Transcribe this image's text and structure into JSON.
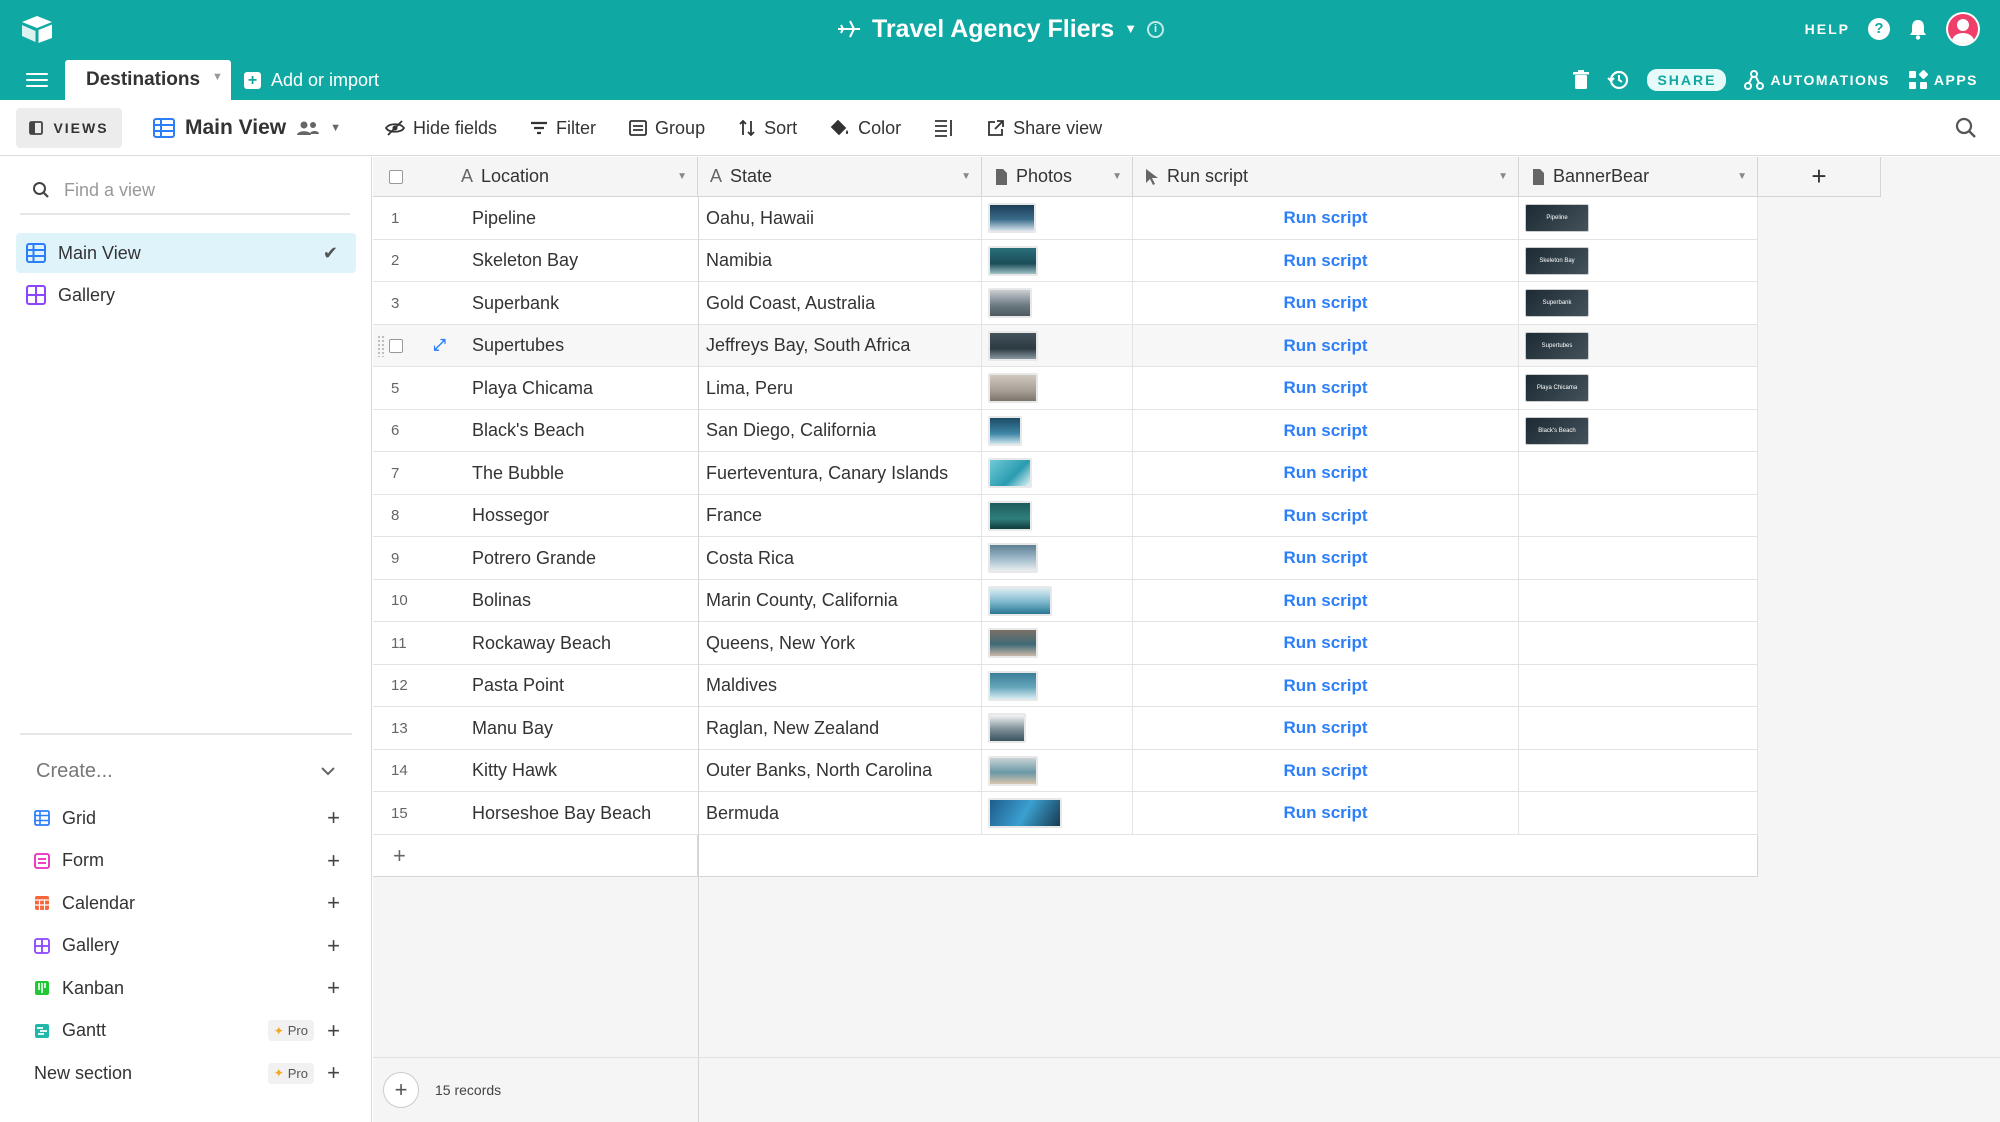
{
  "app": {
    "title": "Travel Agency Fliers",
    "help_label": "HELP",
    "share_label": "SHARE",
    "automations_label": "AUTOMATIONS",
    "apps_label": "APPS",
    "accent_color": "#0fa8a3"
  },
  "tabs": {
    "active_label": "Destinations",
    "add_import_label": "Add or import"
  },
  "toolbar": {
    "views_label": "VIEWS",
    "view_name": "Main View",
    "hide_fields": "Hide fields",
    "filter": "Filter",
    "group": "Group",
    "sort": "Sort",
    "color": "Color",
    "share_view": "Share view"
  },
  "sidebar": {
    "find_placeholder": "Find a view",
    "views": [
      {
        "label": "Main View",
        "icon": "grid-icon",
        "active": true
      },
      {
        "label": "Gallery",
        "icon": "gallery-icon",
        "active": false
      }
    ],
    "create_label": "Create...",
    "create_items": [
      {
        "label": "Grid",
        "icon": "grid-icon",
        "color": "#2d7ff9"
      },
      {
        "label": "Form",
        "icon": "form-icon",
        "color": "#e929ba"
      },
      {
        "label": "Calendar",
        "icon": "calendar-icon",
        "color": "#f7653b"
      },
      {
        "label": "Gallery",
        "icon": "gallery-icon",
        "color": "#8b46ff"
      },
      {
        "label": "Kanban",
        "icon": "kanban-icon",
        "color": "#20c933"
      },
      {
        "label": "Gantt",
        "icon": "gantt-icon",
        "color": "#20b8a8",
        "pro": "Pro"
      },
      {
        "label": "New section",
        "icon": "",
        "pro": "Pro"
      }
    ]
  },
  "table": {
    "columns": [
      "Location",
      "State",
      "Photos",
      "Run script",
      "BannerBear"
    ],
    "button_label": "Run script",
    "rows": [
      {
        "num": "1",
        "location": "Pipeline",
        "state": "Oahu, Hawaii",
        "banner": "Pipeline"
      },
      {
        "num": "2",
        "location": "Skeleton Bay",
        "state": "Namibia",
        "banner": "Skeleton Bay"
      },
      {
        "num": "3",
        "location": "Superbank",
        "state": "Gold Coast, Australia",
        "banner": "Superbank"
      },
      {
        "num": "4",
        "location": "Supertubes",
        "state": "Jeffreys Bay, South Africa",
        "banner": "Supertubes"
      },
      {
        "num": "5",
        "location": "Playa Chicama",
        "state": "Lima, Peru",
        "banner": "Playa Chicama"
      },
      {
        "num": "6",
        "location": "Black's Beach",
        "state": "San Diego, California",
        "banner": "Black's Beach"
      },
      {
        "num": "7",
        "location": "The Bubble",
        "state": "Fuerteventura, Canary Islands",
        "banner": ""
      },
      {
        "num": "8",
        "location": "Hossegor",
        "state": "France",
        "banner": ""
      },
      {
        "num": "9",
        "location": "Potrero Grande",
        "state": "Costa Rica",
        "banner": ""
      },
      {
        "num": "10",
        "location": "Bolinas",
        "state": "Marin County, California",
        "banner": ""
      },
      {
        "num": "11",
        "location": "Rockaway Beach",
        "state": "Queens, New York",
        "banner": ""
      },
      {
        "num": "12",
        "location": "Pasta Point",
        "state": "Maldives",
        "banner": ""
      },
      {
        "num": "13",
        "location": "Manu Bay",
        "state": "Raglan, New Zealand",
        "banner": ""
      },
      {
        "num": "14",
        "location": "Kitty Hawk",
        "state": "Outer Banks, North Carolina",
        "banner": ""
      },
      {
        "num": "15",
        "location": "Horseshoe Bay Beach",
        "state": "Bermuda",
        "banner": ""
      }
    ],
    "records_count": "15 records"
  }
}
